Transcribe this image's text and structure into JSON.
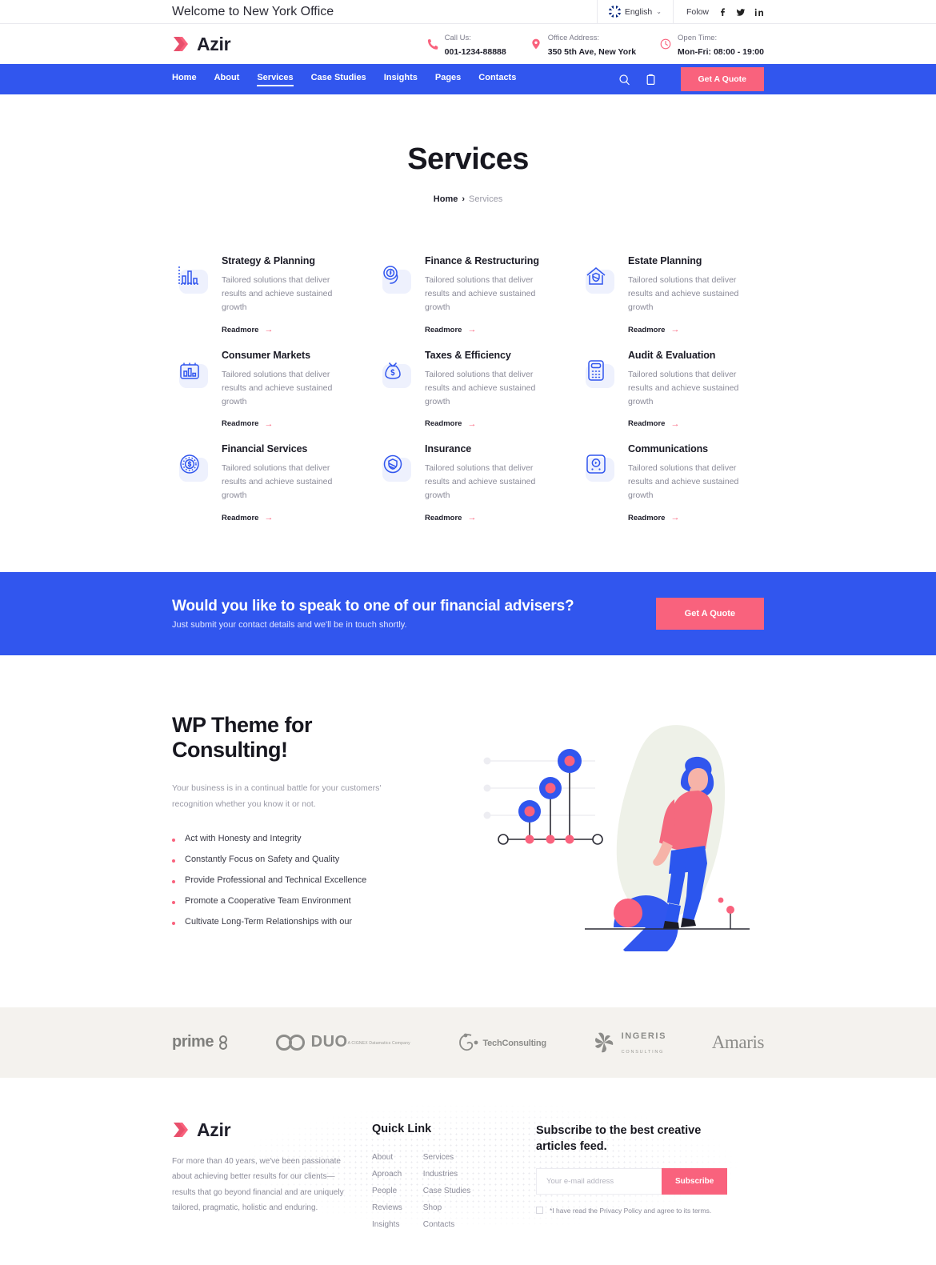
{
  "colors": {
    "primary_blue": "#3156EE",
    "accent_pink": "#F9627D",
    "logo_strip_bg": "#F4F2EE"
  },
  "topbar": {
    "welcome": "Welcome to New York Office",
    "language": "English",
    "caret": "⌄",
    "follow_label": "Folow",
    "socials": [
      "facebook-icon",
      "twitter-icon",
      "linkedin-icon"
    ]
  },
  "header": {
    "brand": "Azir",
    "info": [
      {
        "icon": "phone-icon",
        "label": "Call Us:",
        "value": "001-1234-88888"
      },
      {
        "icon": "map-pin-icon",
        "label": "Office Address:",
        "value": "350 5th Ave, New York"
      },
      {
        "icon": "clock-icon",
        "label": "Open Time:",
        "value": "Mon-Fri: 08:00 - 19:00"
      }
    ]
  },
  "nav": {
    "links": [
      {
        "label": "Home",
        "active": false
      },
      {
        "label": "About",
        "active": false
      },
      {
        "label": "Services",
        "active": true
      },
      {
        "label": "Case Studies",
        "active": false
      },
      {
        "label": "Insights",
        "active": false
      },
      {
        "label": "Pages",
        "active": false
      },
      {
        "label": "Contacts",
        "active": false
      }
    ],
    "search_icon": "search-icon",
    "cart_icon": "clipboard-icon",
    "quote_button": "Get A Quote"
  },
  "hero": {
    "title": "Services",
    "crumb_home": "Home",
    "crumb_sep": "›",
    "crumb_current": "Services"
  },
  "services": {
    "readmore": "Readmore",
    "arrow": "→",
    "items": [
      {
        "icon": "bar-chart-icon",
        "title": "Strategy & Planning",
        "desc": "Tailored solutions that deliver results and achieve sustained growth"
      },
      {
        "icon": "coin-cycle-icon",
        "title": "Finance & Restructuring",
        "desc": "Tailored solutions that deliver results and achieve sustained growth"
      },
      {
        "icon": "house-shield-icon",
        "title": "Estate Planning",
        "desc": "Tailored solutions that deliver results and achieve sustained growth"
      },
      {
        "icon": "chart-box-icon",
        "title": "Consumer Markets",
        "desc": "Tailored solutions that deliver results and achieve sustained growth"
      },
      {
        "icon": "money-bag-icon",
        "title": "Taxes & Efficiency",
        "desc": "Tailored solutions that deliver results and achieve sustained growth"
      },
      {
        "icon": "calculator-icon",
        "title": "Audit & Evaluation",
        "desc": "Tailored solutions that deliver results and achieve sustained growth"
      },
      {
        "icon": "dollar-coin-icon",
        "title": "Financial Services",
        "desc": "Tailored solutions that deliver results and achieve sustained growth"
      },
      {
        "icon": "shield-circle-icon",
        "title": "Insurance",
        "desc": "Tailored solutions that deliver results and achieve sustained growth"
      },
      {
        "icon": "broadcast-icon",
        "title": "Communications",
        "desc": "Tailored solutions that deliver results and achieve sustained growth"
      }
    ]
  },
  "cta": {
    "title": "Would you like to speak to one of our financial advisers?",
    "subtitle": "Just submit your contact details and we'll be in touch shortly.",
    "button": "Get A Quote"
  },
  "wp": {
    "heading": "WP Theme for Consulting!",
    "paragraph": "Your business is in a continual battle for your customers' recognition whether you know it or not.",
    "bullets": [
      "Act with Honesty and Integrity",
      "Constantly Focus on Safety and Quality",
      "Provide Professional and Technical Excellence",
      "Promote a Cooperative Team Environment",
      "Cultivate Long-Term Relationships with our"
    ]
  },
  "logos": [
    {
      "name": "prime",
      "text": "prime"
    },
    {
      "name": "duo",
      "text": "DUO",
      "sub": "A CIGNEX Datamatics Company"
    },
    {
      "name": "techconsulting",
      "text": "TechConsulting"
    },
    {
      "name": "ingeris",
      "text": "INGERIS",
      "sub": "CONSULTING"
    },
    {
      "name": "amaris",
      "text": "Amaris"
    }
  ],
  "footer": {
    "brand": "Azir",
    "about": "For more than 40 years, we've been passionate about achieving better results for our clients—results that go beyond financial and are uniquely tailored, pragmatic, holistic and enduring.",
    "quick_link_heading": "Quick Link",
    "links_col1": [
      "About",
      "Aproach",
      "People",
      "Reviews",
      "Insights"
    ],
    "links_col2": [
      "Services",
      "Industries",
      "Case Studies",
      "Shop",
      "Contacts"
    ],
    "subscribe_heading": "Subscribe to the best creative articles feed.",
    "email_placeholder": "Your e-mail address",
    "email_value": "",
    "subscribe_button": "Subscribe",
    "consent": "*I have read the Privacy Policy and agree to its terms."
  }
}
